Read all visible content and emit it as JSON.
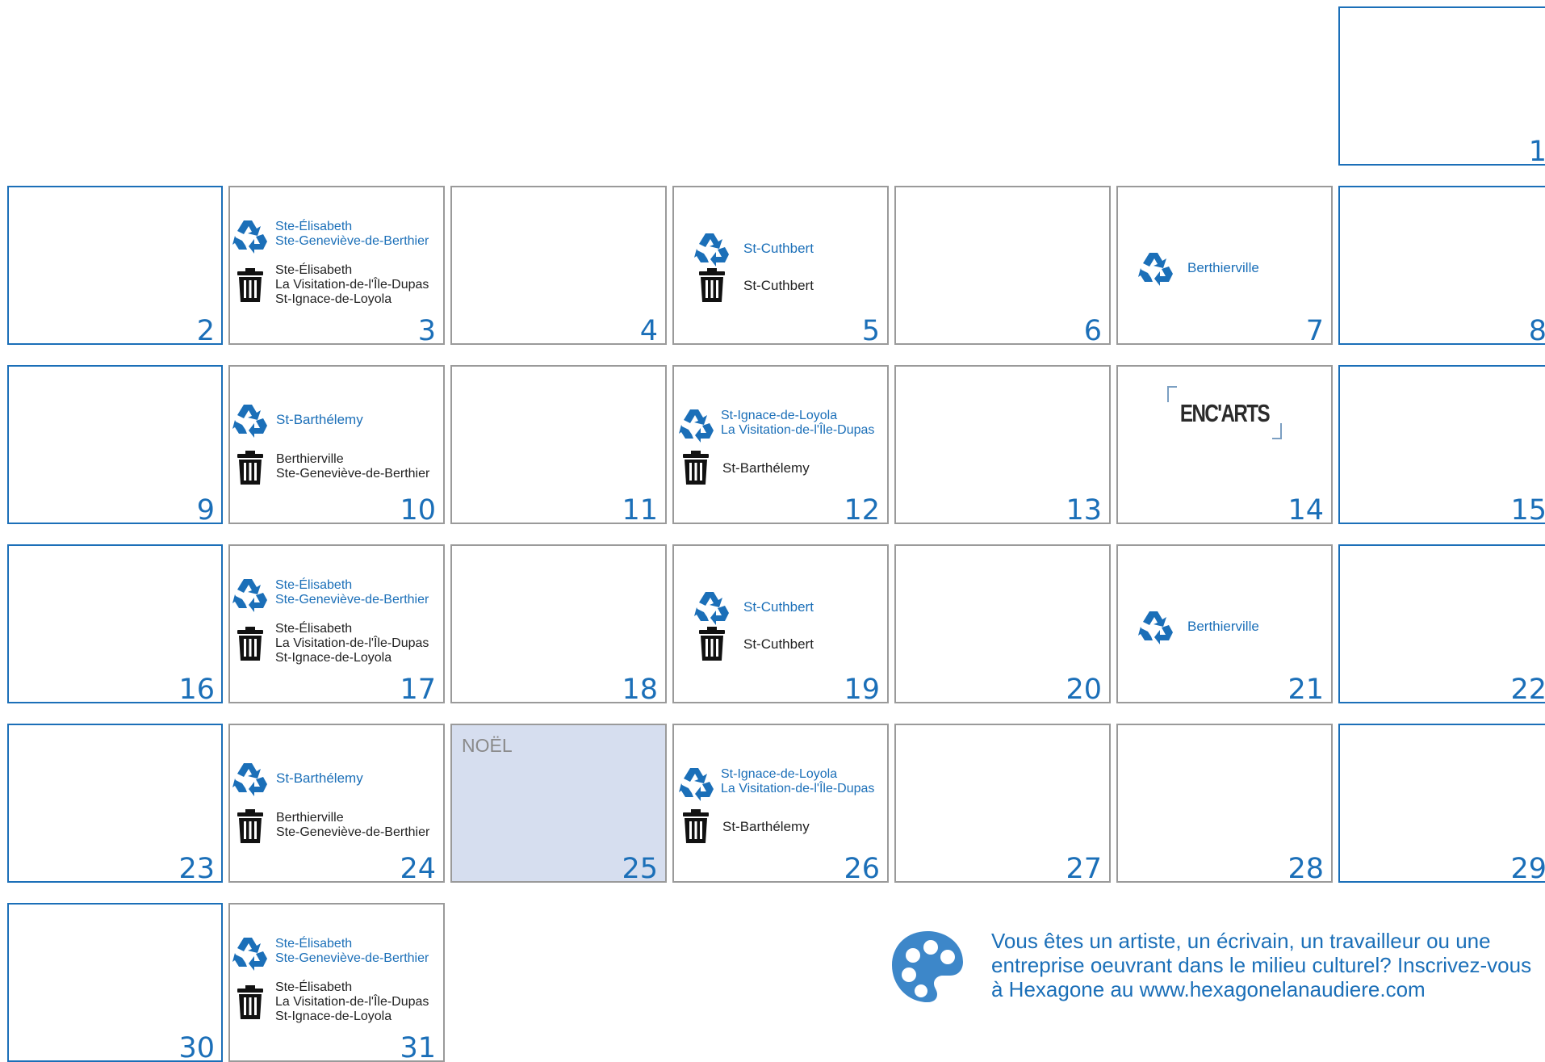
{
  "calendar": {
    "cells": [
      {
        "day": "1"
      },
      {
        "day": "2"
      },
      {
        "day": "3",
        "recycle": [
          "Ste-Élisabeth",
          "Ste-Geneviève-de-Berthier"
        ],
        "trash": [
          "Ste-Élisabeth",
          "La Visitation-de-l'Île-Dupas",
          "St-Ignace-de-Loyola"
        ]
      },
      {
        "day": "4"
      },
      {
        "day": "5",
        "recycle": [
          "St-Cuthbert"
        ],
        "trash": [
          "St-Cuthbert"
        ]
      },
      {
        "day": "6"
      },
      {
        "day": "7",
        "recycle": [
          "Berthierville"
        ]
      },
      {
        "day": "8"
      },
      {
        "day": "9"
      },
      {
        "day": "10",
        "recycle": [
          "St-Barthélemy"
        ],
        "trash": [
          "Berthierville",
          "Ste-Geneviève-de-Berthier"
        ]
      },
      {
        "day": "11"
      },
      {
        "day": "12",
        "recycle": [
          "St-Ignace-de-Loyola",
          "La Visitation-de-l'Île-Dupas"
        ],
        "trash": [
          "St-Barthélemy"
        ]
      },
      {
        "day": "13"
      },
      {
        "day": "14",
        "logo": "ENC'ARTS"
      },
      {
        "day": "15"
      },
      {
        "day": "16"
      },
      {
        "day": "17",
        "recycle": [
          "Ste-Élisabeth",
          "Ste-Geneviève-de-Berthier"
        ],
        "trash": [
          "Ste-Élisabeth",
          "La Visitation-de-l'Île-Dupas",
          "St-Ignace-de-Loyola"
        ]
      },
      {
        "day": "18"
      },
      {
        "day": "19",
        "recycle": [
          "St-Cuthbert"
        ],
        "trash": [
          "St-Cuthbert"
        ]
      },
      {
        "day": "20"
      },
      {
        "day": "21",
        "recycle": [
          "Berthierville"
        ]
      },
      {
        "day": "22"
      },
      {
        "day": "23"
      },
      {
        "day": "24",
        "recycle": [
          "St-Barthélemy"
        ],
        "trash": [
          "Berthierville",
          "Ste-Geneviève-de-Berthier"
        ]
      },
      {
        "day": "25",
        "holiday": "NOËL"
      },
      {
        "day": "26",
        "recycle": [
          "St-Ignace-de-Loyola",
          "La Visitation-de-l'Île-Dupas"
        ],
        "trash": [
          "St-Barthélemy"
        ]
      },
      {
        "day": "27"
      },
      {
        "day": "28"
      },
      {
        "day": "29"
      },
      {
        "day": "30"
      },
      {
        "day": "31",
        "recycle": [
          "Ste-Élisabeth",
          "Ste-Geneviève-de-Berthier"
        ],
        "trash": [
          "Ste-Élisabeth",
          "La Visitation-de-l'Île-Dupas",
          "St-Ignace-de-Loyola"
        ]
      }
    ]
  },
  "footer": {
    "tagline": "Vous êtes un artiste, un écrivain, un travailleur ou une entreprise oeuvrant dans le milieu culturel? Inscrivez-vous à Hexagone au www.hexagonelanaudiere.com"
  },
  "icons": {
    "recycle": "recycle-icon",
    "trash": "trash-icon",
    "palette": "palette-icon"
  },
  "colors": {
    "accent": "#1b6fb8",
    "border": "#9a9a9a",
    "holiday_bg": "#d6deef",
    "text": "#222222"
  }
}
